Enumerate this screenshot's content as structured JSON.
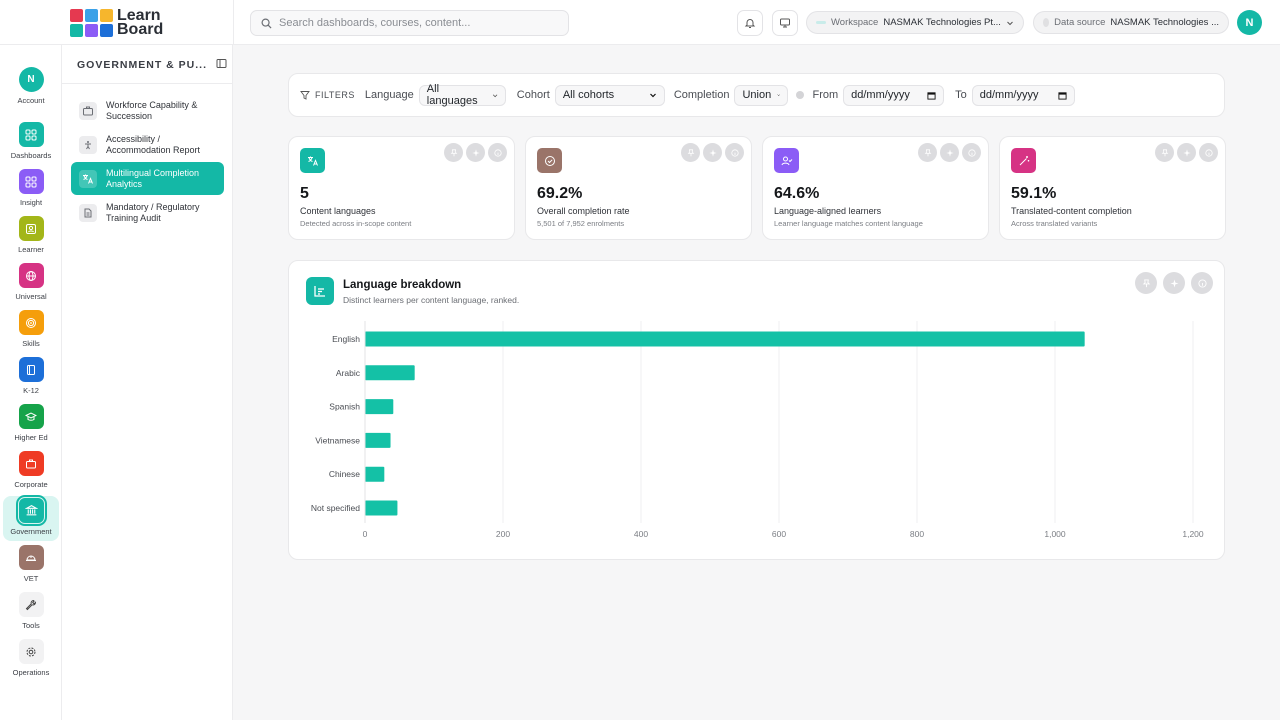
{
  "app": {
    "logo_line1": "Learn",
    "logo_line2": "Board"
  },
  "search": {
    "placeholder": "Search dashboards, courses, content..."
  },
  "header": {
    "workspace_label": "Workspace",
    "workspace_value": "NASMAK Technologies Pt...",
    "datasource_label": "Data source",
    "datasource_value": "NASMAK Technologies ...",
    "avatar_initial": "N"
  },
  "rail": [
    {
      "label": "Account",
      "icon": "avatar-icon",
      "color": "#14b8a6",
      "glyph": "N"
    },
    {
      "label": "Dashboards",
      "icon": "grid-icon",
      "color": "#14b8a6"
    },
    {
      "label": "Insight",
      "icon": "grid-icon",
      "color": "#8b5cf6"
    },
    {
      "label": "Learner",
      "icon": "person-card-icon",
      "color": "#a3b619"
    },
    {
      "label": "Universal",
      "icon": "globe-icon",
      "color": "#d63384"
    },
    {
      "label": "Skills",
      "icon": "target-icon",
      "color": "#f59e0b"
    },
    {
      "label": "K-12",
      "icon": "book-icon",
      "color": "#1d6fd8"
    },
    {
      "label": "Higher Ed",
      "icon": "graduation-cap-icon",
      "color": "#16a34a"
    },
    {
      "label": "Corporate",
      "icon": "briefcase-icon",
      "color": "#ef3b24"
    },
    {
      "label": "Government",
      "icon": "government-building-icon",
      "color": "#14b8a6"
    },
    {
      "label": "VET",
      "icon": "hard-hat-icon",
      "color": "#9a7469"
    },
    {
      "label": "Tools",
      "icon": "wrench-icon",
      "color": "#f2f2f3"
    },
    {
      "label": "Operations",
      "icon": "gear-icon",
      "color": "#f2f2f3"
    }
  ],
  "sidebar": {
    "title": "GOVERNMENT & PU...",
    "items": [
      {
        "label": "Workforce Capability & Succession",
        "icon": "briefcase-icon"
      },
      {
        "label": "Accessibility / Accommodation Report",
        "icon": "accessibility-icon"
      },
      {
        "label": "Multilingual Completion Analytics",
        "icon": "translate-icon"
      },
      {
        "label": "Mandatory / Regulatory Training Audit",
        "icon": "document-icon"
      }
    ]
  },
  "filters": {
    "title": "FILTERS",
    "language_label": "Language",
    "language_value": "All languages",
    "cohort_label": "Cohort",
    "cohort_value": "All cohorts",
    "completion_label": "Completion",
    "completion_value": "Union",
    "from_label": "From",
    "from_value": "dd/mm/yyyy",
    "to_label": "To",
    "to_value": "dd/mm/yyyy"
  },
  "kpis": [
    {
      "value": "5",
      "label": "Content languages",
      "sub": "Detected across in-scope content",
      "icon": "translate-icon",
      "color": "#14b8a6"
    },
    {
      "value": "69.2%",
      "label": "Overall completion rate",
      "sub": "5,501 of 7,952 enrolments",
      "icon": "check-circle-icon",
      "color": "#9a7469"
    },
    {
      "value": "64.6%",
      "label": "Language-aligned learners",
      "sub": "Learner language matches content language",
      "icon": "user-check-icon",
      "color": "#8b5cf6"
    },
    {
      "value": "59.1%",
      "label": "Translated-content completion",
      "sub": "Across translated variants",
      "icon": "magic-wand-icon",
      "color": "#d63384"
    }
  ],
  "breakdown": {
    "title": "Language breakdown",
    "subtitle": "Distinct learners per content language, ranked."
  },
  "chart_data": {
    "type": "bar",
    "orientation": "horizontal",
    "categories": [
      "English",
      "Arabic",
      "Spanish",
      "Vietnamese",
      "Chinese",
      "Not specified"
    ],
    "values": [
      1043,
      72,
      41,
      37,
      28,
      47
    ],
    "xlim": [
      0,
      1200
    ],
    "xticks": [
      "0",
      "200",
      "400",
      "600",
      "800",
      "1,000",
      "1,200"
    ],
    "bar_color": "#14c1a6",
    "grid": true
  }
}
